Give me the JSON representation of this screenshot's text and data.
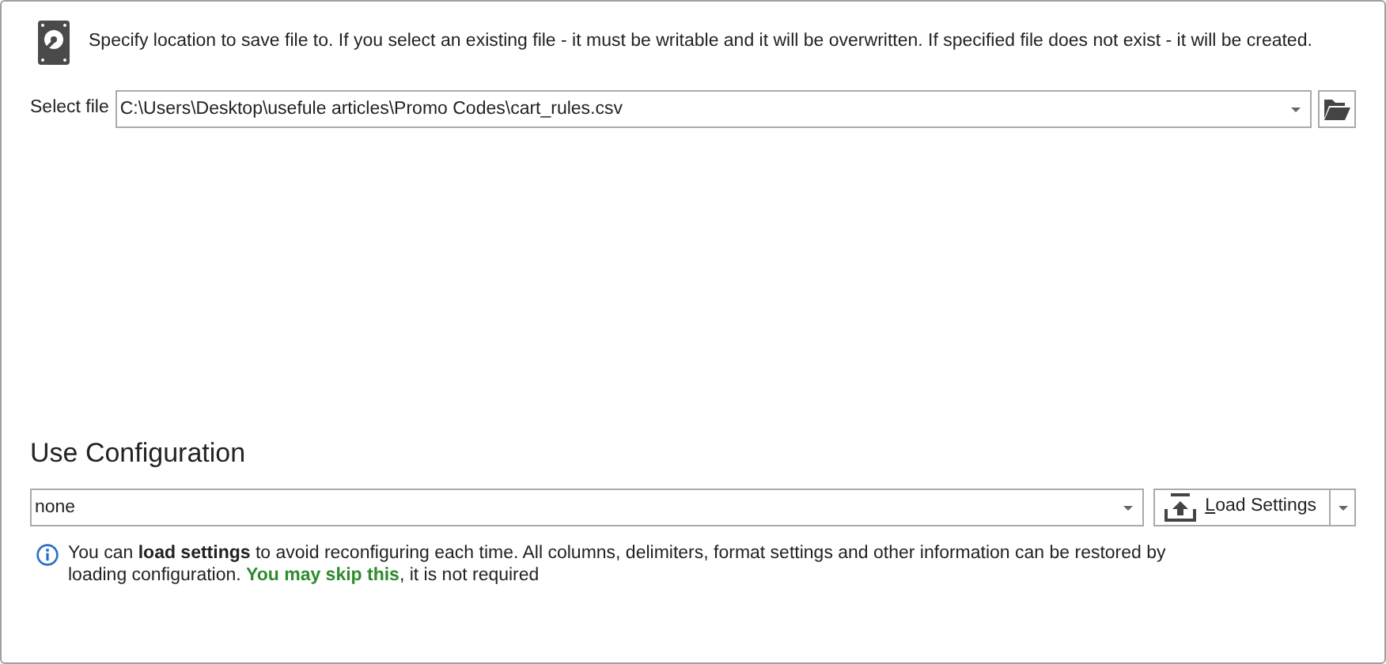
{
  "header": {
    "text": "Specify location to save file to. If you select an existing file - it must be writable and it will be overwritten. If specified file does not exist - it will be created."
  },
  "file": {
    "label": "Select file",
    "value": "C:\\Users\\Desktop\\usefule articles\\Promo Codes\\cart_rules.csv"
  },
  "configuration": {
    "title": "Use Configuration",
    "value": "none",
    "button": "Load Settings",
    "note": [
      {
        "kind": "plain",
        "text": "You can "
      },
      {
        "kind": "bold",
        "text": "load settings"
      },
      {
        "kind": "plain",
        "text": " to avoid reconfiguring each time. All columns, delimiters, format settings and other information can be restored by loading configuration. "
      },
      {
        "kind": "green",
        "text": "You may skip this"
      },
      {
        "kind": "plain",
        "text": ", it is not required"
      }
    ]
  }
}
